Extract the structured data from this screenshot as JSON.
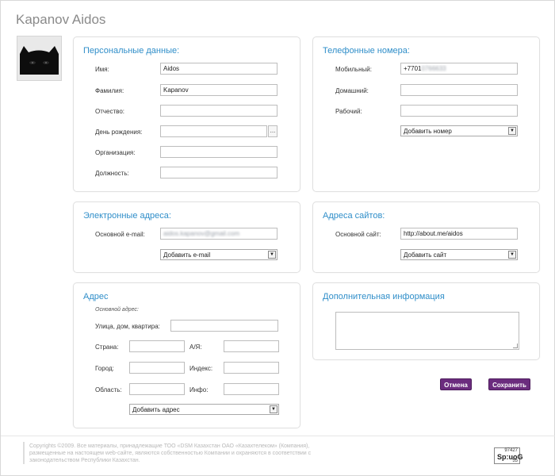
{
  "page": {
    "title": "Kapanov Aidos"
  },
  "personal": {
    "title": "Персональные данные:",
    "first_name_label": "Имя:",
    "first_name_value": "Aidos",
    "last_name_label": "Фамилия:",
    "last_name_value": "Kapanov",
    "patronymic_label": "Отчество:",
    "patronymic_value": "",
    "birthday_label": "День рождения:",
    "birthday_value": "",
    "birthday_button": "...",
    "organization_label": "Организация:",
    "organization_value": "",
    "position_label": "Должность:",
    "position_value": ""
  },
  "phones": {
    "title": "Телефонные номера:",
    "mobile_label": "Мобильный:",
    "mobile_value": "+7701",
    "mobile_hidden": "0766633",
    "home_label": "Домашний:",
    "home_value": "",
    "work_label": "Рабочий:",
    "work_value": "",
    "add_select": "Добавить номер"
  },
  "emails": {
    "title": "Электронные адреса:",
    "main_label": "Основной e-mail:",
    "main_value": "aidos.kapanov@gmail.com",
    "add_select": "Добавить e-mail"
  },
  "sites": {
    "title": "Адреса сайтов:",
    "main_label": "Основной сайт:",
    "main_value": "http://about.me/aidos",
    "add_select": "Добавить сайт"
  },
  "address": {
    "title": "Адрес",
    "sub_label": "Основной адрес:",
    "street_label": "Улица, дом, квартира:",
    "country_label": "Страна:",
    "po_label": "А/Я:",
    "city_label": "Город:",
    "zip_label": "Индекс:",
    "region_label": "Область:",
    "info_label": "Инфо:",
    "add_select": "Добавить адрес"
  },
  "extra": {
    "title": "Дополнительная информация"
  },
  "actions": {
    "cancel": "Отмена",
    "save": "Сохранить"
  },
  "footer": {
    "copyright": "Copyrights ©2009. Все материалы, принадлежащие ТОО «DSM Казахстан ОАО «Казахтелеком» (Компания), размещенные на настоящем web-сайте, являются собственностью Компании и охраняются в соответствии с законодательством Республики Казахстан.",
    "counter_top": "97427",
    "counter_bottom": "55",
    "counter_logo": "Sp:uoG"
  },
  "colors": {
    "accent": "#2f8ec9",
    "button": "#6b2c7e"
  }
}
